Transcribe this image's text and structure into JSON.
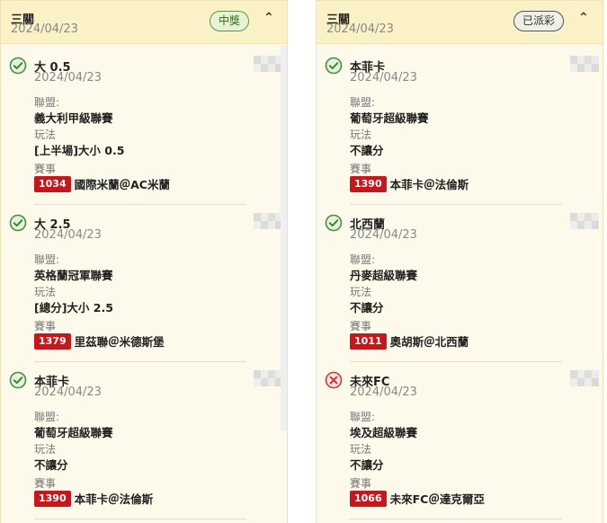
{
  "cards": [
    {
      "title": "三關",
      "date": "2024/04/23",
      "badge": "中獎",
      "legs": [
        {
          "status": "won",
          "status_icon": "check-circle-icon",
          "selection": "大 0.5",
          "date": "2024/04/23",
          "league_label": "聯盟:",
          "league": "義大利甲級聯賽",
          "market_label": "玩法",
          "market": "[上半場]大小 0.5",
          "event_label": "賽事",
          "match_code": "1034",
          "match": "國際米蘭＠AC米蘭"
        },
        {
          "status": "won",
          "status_icon": "check-circle-icon",
          "selection": "大 2.5",
          "date": "2024/04/23",
          "league_label": "聯盟:",
          "league": "英格蘭冠軍聯賽",
          "market_label": "玩法",
          "market": "[總分]大小 2.5",
          "event_label": "賽事",
          "match_code": "1379",
          "match": "里茲聯＠米德斯堡"
        },
        {
          "status": "won",
          "status_icon": "check-circle-icon",
          "selection": "本菲卡",
          "date": "2024/04/23",
          "league_label": "聯盟:",
          "league": "葡萄牙超級聯賽",
          "market_label": "玩法",
          "market": "不讓分",
          "event_label": "賽事",
          "match_code": "1390",
          "match": "本菲卡＠法倫斯"
        }
      ]
    },
    {
      "title": "三關",
      "date": "2024/04/23",
      "badge": "已派彩",
      "legs": [
        {
          "status": "won",
          "status_icon": "check-circle-icon",
          "selection": "本菲卡",
          "date": "2024/04/23",
          "league_label": "聯盟:",
          "league": "葡萄牙超級聯賽",
          "market_label": "玩法",
          "market": "不讓分",
          "event_label": "賽事",
          "match_code": "1390",
          "match": "本菲卡＠法倫斯"
        },
        {
          "status": "won",
          "status_icon": "check-circle-icon",
          "selection": "北西蘭",
          "date": "2024/04/23",
          "league_label": "聯盟:",
          "league": "丹麥超級聯賽",
          "market_label": "玩法",
          "market": "不讓分",
          "event_label": "賽事",
          "match_code": "1011",
          "match": "奧胡斯＠北西蘭"
        },
        {
          "status": "lost",
          "status_icon": "x-circle-icon",
          "selection": "未來FC",
          "date": "2024/04/23",
          "league_label": "聯盟:",
          "league": "埃及超級聯賽",
          "market_label": "玩法",
          "market": "不讓分",
          "event_label": "賽事",
          "match_code": "1066",
          "match": "未來FC＠達克爾亞"
        }
      ]
    }
  ],
  "colors": {
    "win": "#4a8f3a",
    "loss": "#d23a3a",
    "code_bg": "#c8161d"
  }
}
